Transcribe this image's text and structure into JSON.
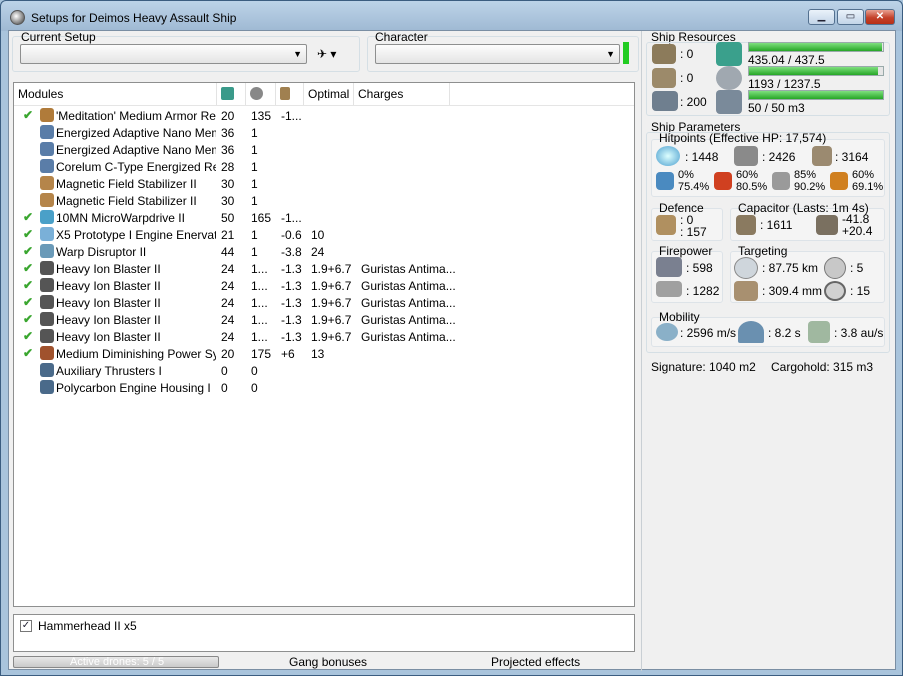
{
  "window": {
    "title": "Setups for Deimos Heavy Assault Ship"
  },
  "setup": {
    "label": "Current Setup",
    "value": ""
  },
  "character": {
    "label": "Character",
    "value": ""
  },
  "modules": {
    "headers": {
      "name": "Modules",
      "optimal": "Optimal",
      "charges": "Charges"
    },
    "rows": [
      {
        "check": "✔",
        "name": "'Meditation' Medium Armor Rep...",
        "cpu": "20",
        "pg": "135",
        "cap": "-1...",
        "optimal": "",
        "charges": "",
        "color": "#b07b3a"
      },
      {
        "check": "",
        "name": "Energized Adaptive Nano Mem...",
        "cpu": "36",
        "pg": "1",
        "cap": "",
        "optimal": "",
        "charges": "",
        "color": "#5a7da8"
      },
      {
        "check": "",
        "name": "Energized Adaptive Nano Mem...",
        "cpu": "36",
        "pg": "1",
        "cap": "",
        "optimal": "",
        "charges": "",
        "color": "#5a7da8"
      },
      {
        "check": "",
        "name": "Corelum C-Type Energized Rea...",
        "cpu": "28",
        "pg": "1",
        "cap": "",
        "optimal": "",
        "charges": "",
        "color": "#5a7da8"
      },
      {
        "check": "",
        "name": "Magnetic Field Stabilizer II",
        "cpu": "30",
        "pg": "1",
        "cap": "",
        "optimal": "",
        "charges": "",
        "color": "#b5854a"
      },
      {
        "check": "",
        "name": "Magnetic Field Stabilizer II",
        "cpu": "30",
        "pg": "1",
        "cap": "",
        "optimal": "",
        "charges": "",
        "color": "#b5854a"
      },
      {
        "check": "✔",
        "name": "10MN MicroWarpdrive II",
        "cpu": "50",
        "pg": "165",
        "cap": "-1...",
        "optimal": "",
        "charges": "",
        "color": "#4aa0c8"
      },
      {
        "check": "✔",
        "name": "X5 Prototype I Engine Enervator",
        "cpu": "21",
        "pg": "1",
        "cap": "-0.6",
        "optimal": "10",
        "charges": "",
        "color": "#7ab0d8"
      },
      {
        "check": "✔",
        "name": "Warp Disruptor II",
        "cpu": "44",
        "pg": "1",
        "cap": "-3.8",
        "optimal": "24",
        "charges": "",
        "color": "#6a9ab8"
      },
      {
        "check": "✔",
        "name": "Heavy Ion Blaster II",
        "cpu": "24",
        "pg": "1...",
        "cap": "-1.3",
        "optimal": "1.9+6.7",
        "charges": "Guristas Antima...",
        "color": "#555"
      },
      {
        "check": "✔",
        "name": "Heavy Ion Blaster II",
        "cpu": "24",
        "pg": "1...",
        "cap": "-1.3",
        "optimal": "1.9+6.7",
        "charges": "Guristas Antima...",
        "color": "#555"
      },
      {
        "check": "✔",
        "name": "Heavy Ion Blaster II",
        "cpu": "24",
        "pg": "1...",
        "cap": "-1.3",
        "optimal": "1.9+6.7",
        "charges": "Guristas Antima...",
        "color": "#555"
      },
      {
        "check": "✔",
        "name": "Heavy Ion Blaster II",
        "cpu": "24",
        "pg": "1...",
        "cap": "-1.3",
        "optimal": "1.9+6.7",
        "charges": "Guristas Antima...",
        "color": "#555"
      },
      {
        "check": "✔",
        "name": "Heavy Ion Blaster II",
        "cpu": "24",
        "pg": "1...",
        "cap": "-1.3",
        "optimal": "1.9+6.7",
        "charges": "Guristas Antima...",
        "color": "#555"
      },
      {
        "check": "✔",
        "name": "Medium Diminishing Power Sys...",
        "cpu": "20",
        "pg": "175",
        "cap": "+6",
        "optimal": "13",
        "charges": "",
        "color": "#a0522d"
      },
      {
        "check": "",
        "name": "Auxiliary Thrusters I",
        "cpu": "0",
        "pg": "0",
        "cap": "",
        "optimal": "",
        "charges": "",
        "color": "#4a6a8a"
      },
      {
        "check": "",
        "name": "Polycarbon Engine Housing I",
        "cpu": "0",
        "pg": "0",
        "cap": "",
        "optimal": "",
        "charges": "",
        "color": "#4a6a8a"
      }
    ]
  },
  "drones": {
    "item": "Hammerhead II x5",
    "checked": true
  },
  "bottom": {
    "active_drones": "Active drones: 5 / 5",
    "gang": "Gang bonuses",
    "projected": "Projected effects"
  },
  "resources": {
    "title": "Ship Resources",
    "turret": ": 0",
    "launcher": ": 0",
    "calibration": ": 200",
    "cpu": "435.04 / 437.5",
    "cpu_frac": 0.994,
    "pg": "1193 / 1237.5",
    "pg_frac": 0.964,
    "drone": "50 / 50 m3",
    "drone_frac": 1.0
  },
  "params": {
    "title": "Ship Parameters",
    "hp_title": "Hitpoints (Effective HP: 17,574)",
    "shield": ": 1448",
    "armor": ": 2426",
    "structure": ": 3164",
    "resist1": "0%",
    "resist1b": "75.4%",
    "resist2": "60%",
    "resist2b": "80.5%",
    "resist3": "85%",
    "resist3b": "90.2%",
    "resist4": "60%",
    "resist4b": "69.1%",
    "defence_title": "Defence",
    "def1": ": 0",
    "def2": ": 157",
    "cap_title": "Capacitor (Lasts: 1m 4s)",
    "cap_amount": ": 1611",
    "cap_use": "-41.8",
    "cap_regen": "+20.4",
    "fire_title": "Firepower",
    "fire1": ": 598",
    "fire2": ": 1282",
    "target_title": "Targeting",
    "t_range": ": 87.75 km",
    "t_max": ": 5",
    "t_res": ": 309.4 mm",
    "t_sensor": ": 15",
    "mob_title": "Mobility",
    "speed": ": 2596 m/s",
    "align": ": 8.2 s",
    "warp": ": 3.8 au/s",
    "signature": "Signature: 1040 m2",
    "cargohold": "Cargohold: 315 m3"
  },
  "colors": {
    "bar_green": "#26a626",
    "check_green": "#3aa62f"
  }
}
